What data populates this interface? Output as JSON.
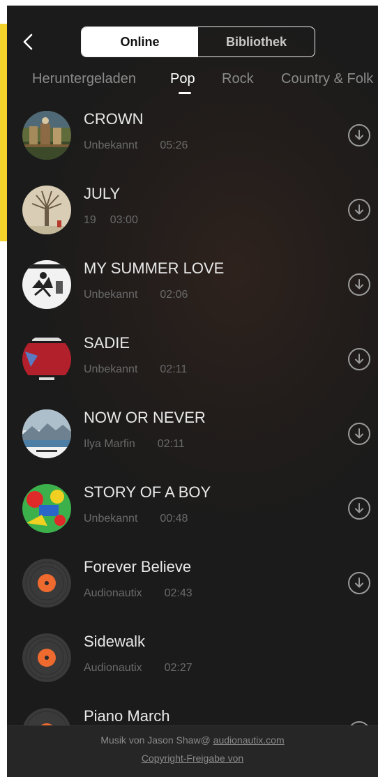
{
  "nav": {
    "back_icon": "chevron-left-icon"
  },
  "segment": {
    "online": "Online",
    "library": "Bibliothek",
    "selected": "Online"
  },
  "tabs": [
    {
      "label": "Heruntergeladen"
    },
    {
      "label": "Pop",
      "active": true
    },
    {
      "label": "Rock"
    },
    {
      "label": "Country & Folk"
    }
  ],
  "songs": [
    {
      "title": "CROWN",
      "artist": "Unbekannt",
      "duration": "05:26",
      "icon": "download-icon"
    },
    {
      "title": "JULY",
      "artist": "19",
      "duration": "03:00",
      "icon": "download-icon"
    },
    {
      "title": "MY SUMMER LOVE",
      "artist": "Unbekannt",
      "duration": "02:06",
      "icon": "download-icon"
    },
    {
      "title": "SADIE",
      "artist": "Unbekannt",
      "duration": "02:11",
      "icon": "download-icon"
    },
    {
      "title": "NOW OR NEVER",
      "artist": "Ilya Marfin",
      "duration": "02:11",
      "icon": "download-icon"
    },
    {
      "title": "STORY OF A BOY",
      "artist": "Unbekannt",
      "duration": "00:48",
      "icon": "download-icon"
    },
    {
      "title": "Forever Believe",
      "artist": "Audionautix",
      "duration": "02:43",
      "icon": "download-icon"
    },
    {
      "title": "Sidewalk",
      "artist": "Audionautix",
      "duration": "02:27"
    },
    {
      "title": "Piano March",
      "artist": "",
      "duration": "",
      "icon": "download-icon"
    }
  ],
  "footer": {
    "credit_prefix": "Musik von Jason Shaw@ ",
    "credit_link": "audionautix.com",
    "copyright": "Copyright-Freigabe von"
  },
  "colors": {
    "accent_yellow": "#f4d22c",
    "vinyl_label": "#ef6a2e",
    "background": "#1b1b1b"
  }
}
